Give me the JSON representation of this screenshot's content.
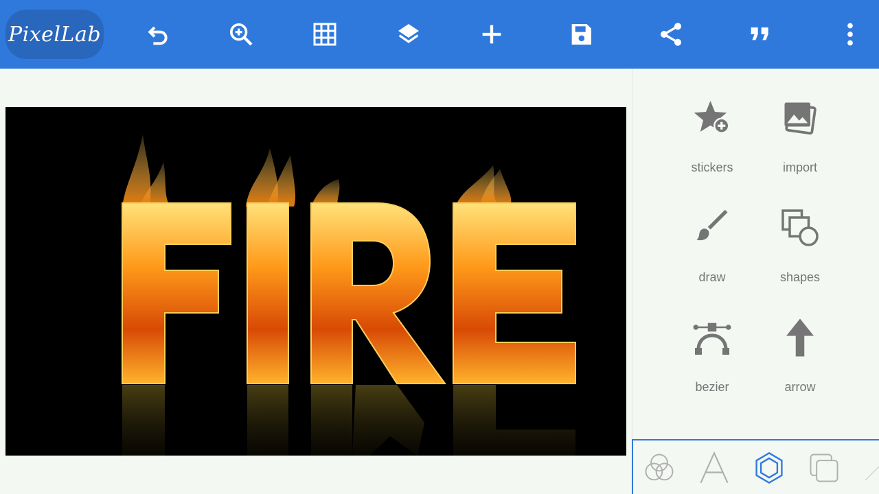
{
  "app": {
    "logo_text": "PixelLab"
  },
  "toolbar": {
    "icons": [
      "undo-icon",
      "zoom-in-icon",
      "grid-icon",
      "layers-icon",
      "add-icon",
      "save-icon",
      "share-icon",
      "quote-icon",
      "more-vert-icon"
    ]
  },
  "canvas": {
    "text": "FIRE"
  },
  "panel": {
    "items": [
      {
        "label": "stickers",
        "icon": "sticker-add-icon"
      },
      {
        "label": "import",
        "icon": "image-import-icon"
      },
      {
        "label": "draw",
        "icon": "brush-icon"
      },
      {
        "label": "shapes",
        "icon": "shapes-icon"
      },
      {
        "label": "bezier",
        "icon": "bezier-icon"
      },
      {
        "label": "arrow",
        "icon": "arrow-up-icon"
      }
    ]
  },
  "bottom_tabs": {
    "items": [
      {
        "name": "effects-tab",
        "icon": "circles-icon",
        "active": false
      },
      {
        "name": "text-tab",
        "icon": "text-a-icon",
        "active": false
      },
      {
        "name": "shapes-tab",
        "icon": "hexagon-icon",
        "active": true
      },
      {
        "name": "layers-tab",
        "icon": "copy-icon",
        "active": false
      }
    ]
  },
  "colors": {
    "toolbar_bg": "#3079dc",
    "accent": "#3079dc",
    "icon_gray": "#757575"
  }
}
